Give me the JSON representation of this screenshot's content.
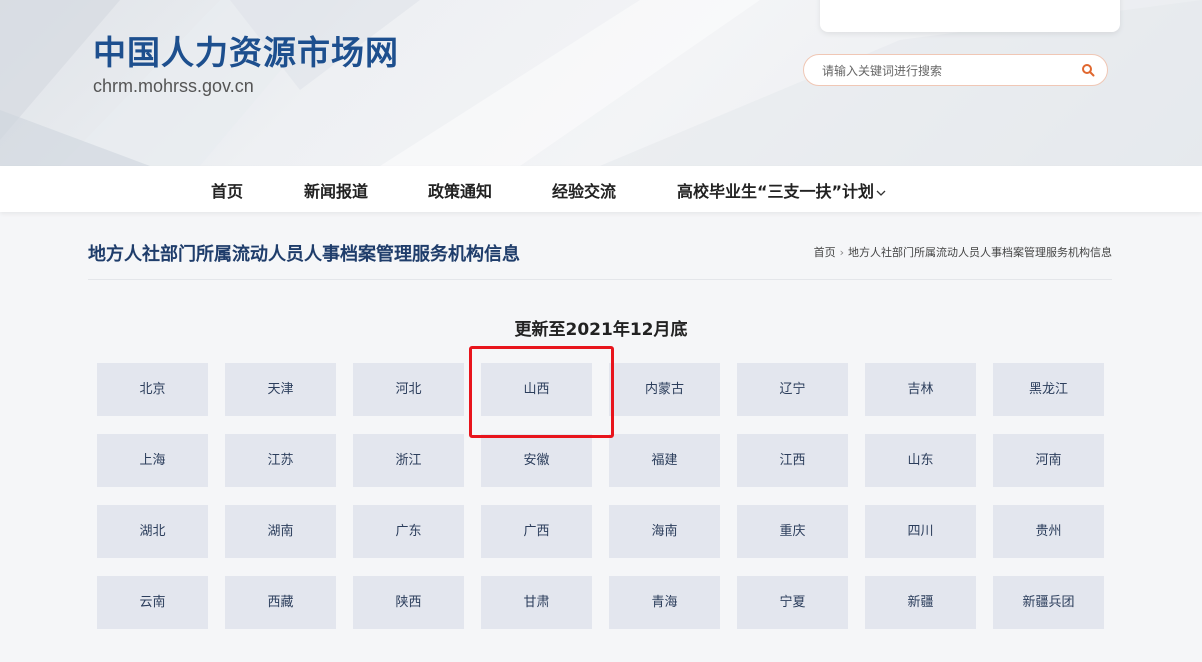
{
  "site": {
    "title": "中国人力资源市场网",
    "domain": "chrm.mohrss.gov.cn"
  },
  "search": {
    "placeholder": "请输入关键词进行搜索",
    "icon": "search-icon"
  },
  "nav": {
    "items": [
      {
        "label": "首页"
      },
      {
        "label": "新闻报道"
      },
      {
        "label": "政策通知"
      },
      {
        "label": "经验交流"
      },
      {
        "label": "高校毕业生“三支一扶”计划",
        "icon": "chevron-down-icon"
      }
    ]
  },
  "page": {
    "title": "地方人社部门所属流动人员人事档案管理服务机构信息",
    "breadcrumb": [
      "首页",
      "地方人社部门所属流动人员人事档案管理服务机构信息"
    ],
    "update_title": "更新至2021年12月底"
  },
  "provinces": [
    "北京",
    "天津",
    "河北",
    "山西",
    "内蒙古",
    "辽宁",
    "吉林",
    "黑龙江",
    "上海",
    "江苏",
    "浙江",
    "安徽",
    "福建",
    "江西",
    "山东",
    "河南",
    "湖北",
    "湖南",
    "广东",
    "广西",
    "海南",
    "重庆",
    "四川",
    "贵州",
    "云南",
    "西藏",
    "陕西",
    "甘肃",
    "青海",
    "宁夏",
    "新疆",
    "新疆兵团"
  ],
  "colors": {
    "brand": "#1d4f8e",
    "highlight": "#e8141c",
    "cell_bg": "#e3e6ee"
  }
}
